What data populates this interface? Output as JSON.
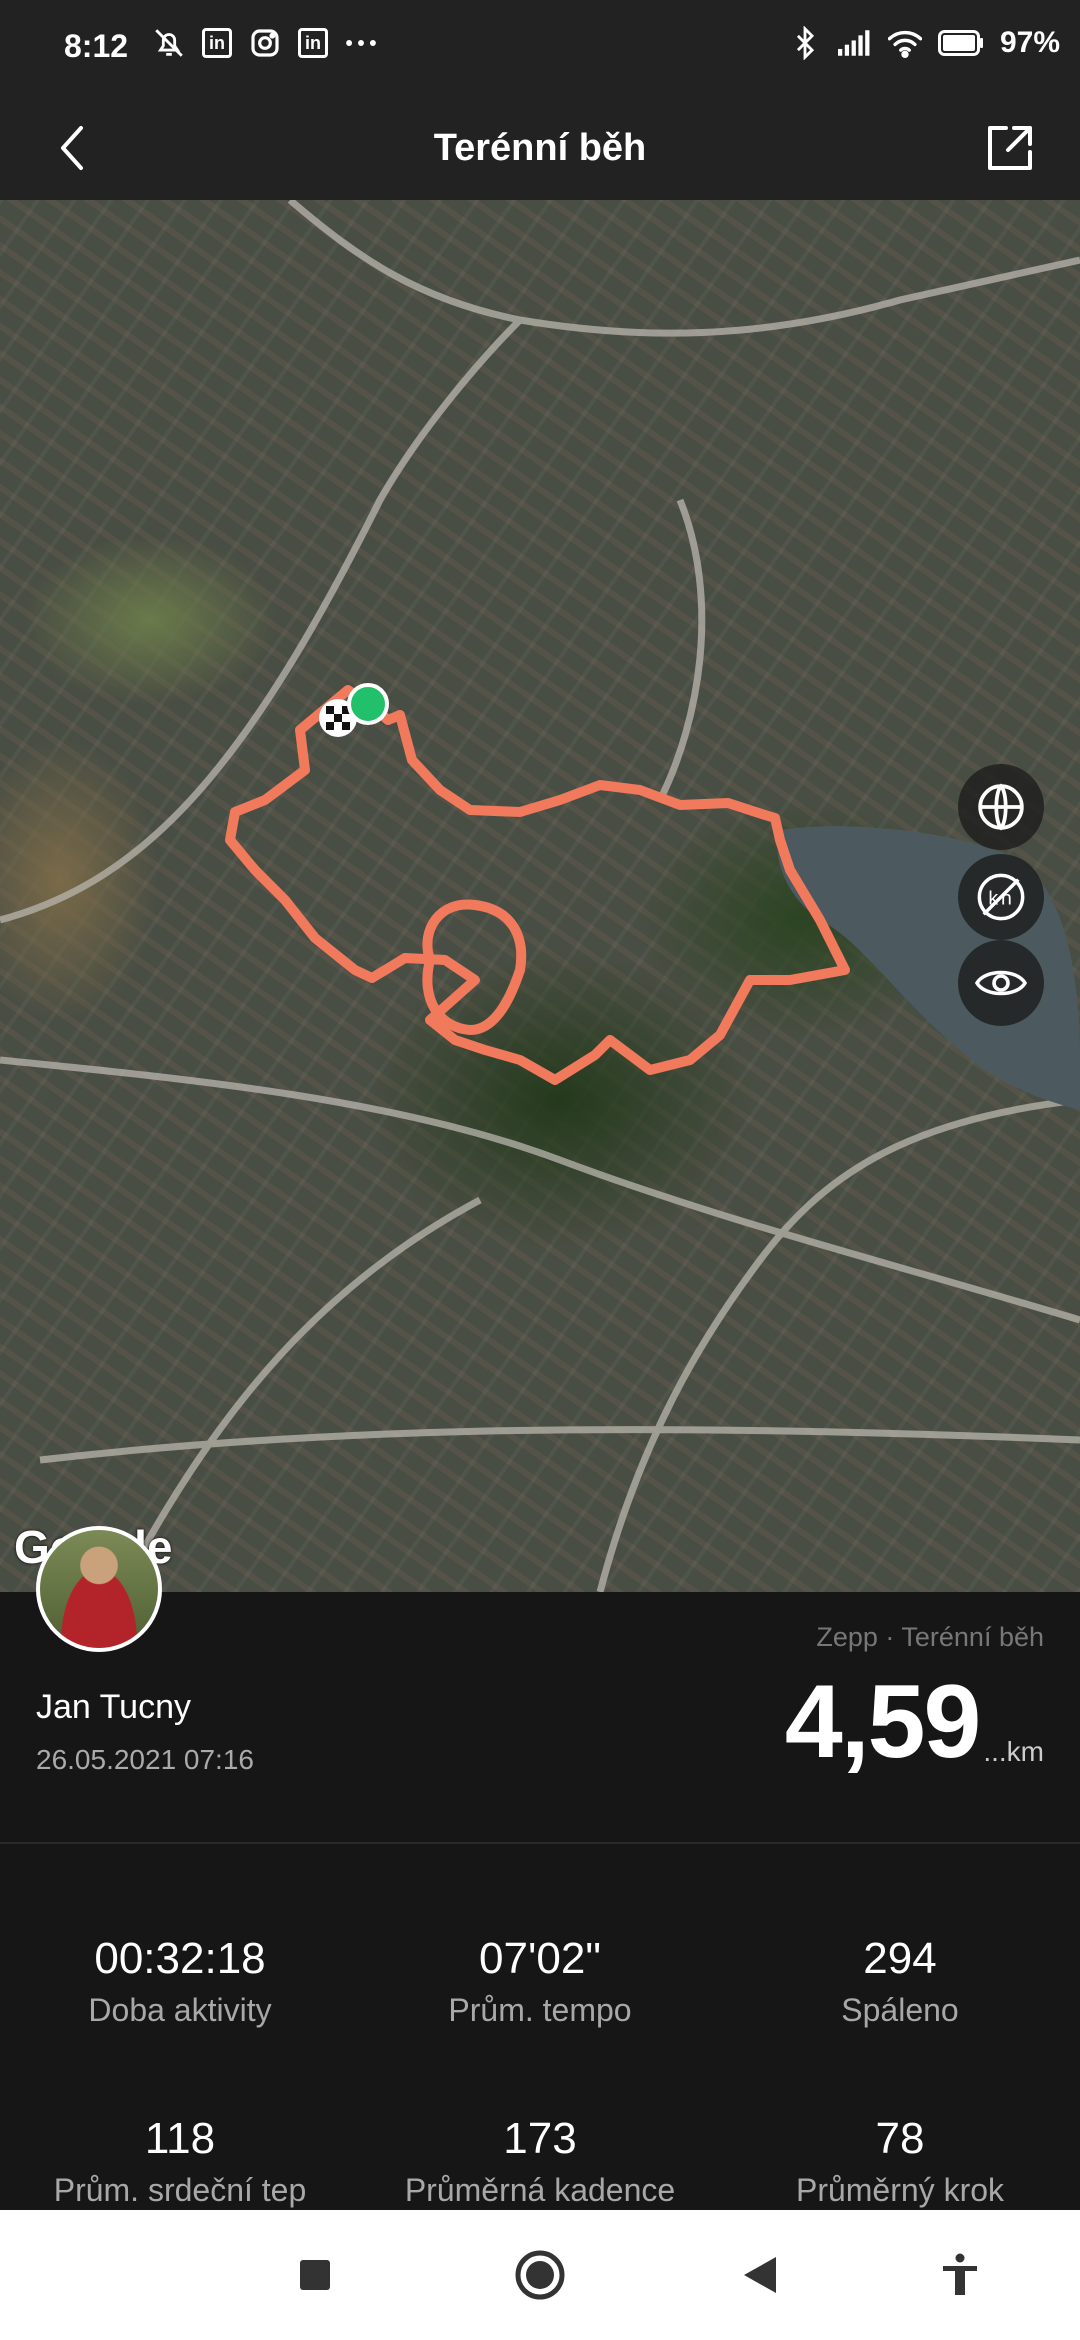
{
  "status_bar": {
    "time": "8:12",
    "left_icons": [
      "notifications-off-icon",
      "linkedin-icon",
      "instagram-icon",
      "linkedin-icon",
      "more-icon"
    ],
    "right_icons": [
      "bluetooth-icon",
      "signal-icon",
      "wifi-icon",
      "battery-icon"
    ],
    "battery_percent": "97%"
  },
  "header": {
    "title": "Terénní běh",
    "back_icon": "chevron-left-icon",
    "share_icon": "share-external-icon"
  },
  "map": {
    "provider_logo": "Google",
    "route_color": "#F07A5B",
    "start_marker_color": "#22C06A",
    "controls": [
      "globe-icon",
      "km-markers-off-icon",
      "eye-icon"
    ]
  },
  "activity": {
    "user_name": "Jan Tucny",
    "date_time": "26.05.2021 07:16",
    "source": "Zepp · Terénní běh",
    "distance_value": "4,59",
    "distance_unit": "...km"
  },
  "stats": [
    {
      "value": "00:32:18",
      "label": "Doba aktivity"
    },
    {
      "value": "07'02\"",
      "label": "Prům. tempo"
    },
    {
      "value": "294",
      "label": "Spáleno"
    },
    {
      "value": "118",
      "label": "Prům. srdeční tep"
    },
    {
      "value": "173",
      "label": "Průměrná kadence"
    },
    {
      "value": "78",
      "label": "Průměrný krok"
    }
  ],
  "nav_bar": {
    "buttons": [
      "recents-square-icon",
      "home-circle-icon",
      "back-triangle-icon",
      "accessibility-icon"
    ]
  }
}
